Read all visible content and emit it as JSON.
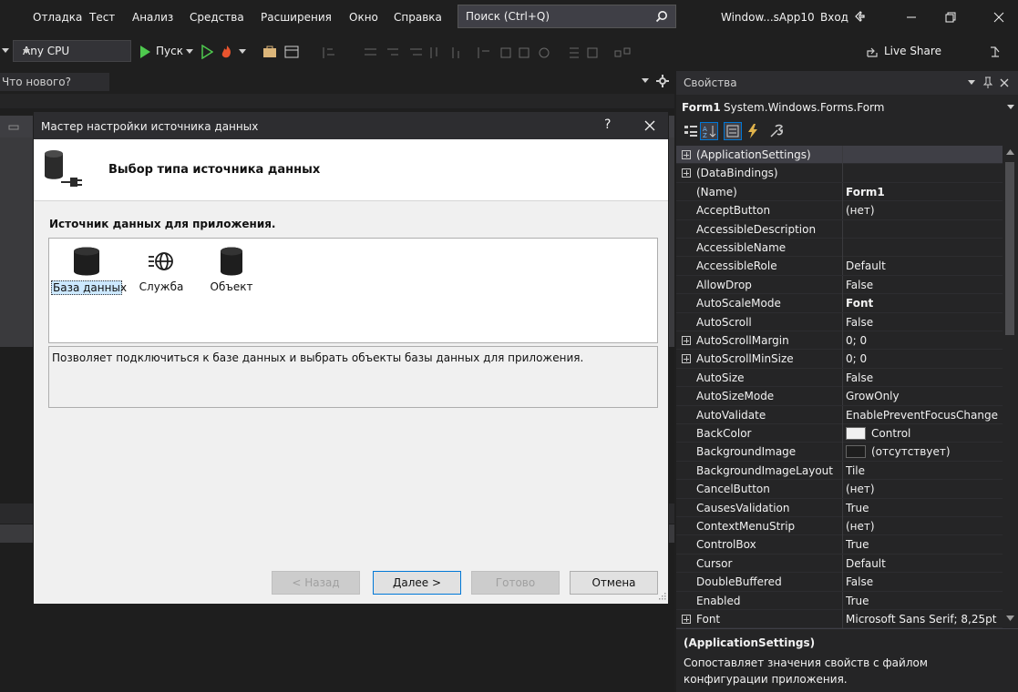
{
  "menu": {
    "items": [
      "Отладка",
      "Тест",
      "Анализ",
      "Средства",
      "Расширения",
      "Окно",
      "Справка"
    ],
    "search_placeholder": "Поиск (Ctrl+Q)",
    "window_title": "Window...sApp10",
    "signin": "Вход"
  },
  "toolbar": {
    "platform": "Any CPU",
    "run_label": "Пуск",
    "live_share": "Live Share"
  },
  "doc_tab": {
    "label": "Что нового?"
  },
  "wizard": {
    "title": "Мастер настройки источника данных",
    "help": "?",
    "heading": "Выбор типа источника данных",
    "source_label": "Источник данных для приложения.",
    "sources": [
      {
        "label": "База данных",
        "icon": "database-icon",
        "selected": true
      },
      {
        "label": "Служба",
        "icon": "service-globe-icon",
        "selected": false
      },
      {
        "label": "Объект",
        "icon": "object-cylinder-icon",
        "selected": false
      }
    ],
    "description": "Позволяет подключиться к базе данных и выбрать объекты базы данных для приложения.",
    "buttons": {
      "back": "< Назад",
      "next": "Далее >",
      "finish": "Готово",
      "cancel": "Отмена"
    }
  },
  "properties": {
    "title": "Свойства",
    "object_name": "Form1",
    "object_type": "System.Windows.Forms.Form",
    "rows": [
      {
        "name": "(ApplicationSettings)",
        "value": "",
        "expandable": true,
        "selected": true
      },
      {
        "name": "(DataBindings)",
        "value": "",
        "expandable": true
      },
      {
        "name": "(Name)",
        "value": "Form1",
        "bold": true
      },
      {
        "name": "AcceptButton",
        "value": "(нет)"
      },
      {
        "name": "AccessibleDescription",
        "value": ""
      },
      {
        "name": "AccessibleName",
        "value": ""
      },
      {
        "name": "AccessibleRole",
        "value": "Default"
      },
      {
        "name": "AllowDrop",
        "value": "False"
      },
      {
        "name": "AutoScaleMode",
        "value": "Font",
        "bold": true
      },
      {
        "name": "AutoScroll",
        "value": "False"
      },
      {
        "name": "AutoScrollMargin",
        "value": "0; 0",
        "expandable": true
      },
      {
        "name": "AutoScrollMinSize",
        "value": "0; 0",
        "expandable": true
      },
      {
        "name": "AutoSize",
        "value": "False"
      },
      {
        "name": "AutoSizeMode",
        "value": "GrowOnly"
      },
      {
        "name": "AutoValidate",
        "value": "EnablePreventFocusChange"
      },
      {
        "name": "BackColor",
        "value": "Control",
        "swatch": "#f0f0f0"
      },
      {
        "name": "BackgroundImage",
        "value": "(отсутствует)",
        "swatch": "#1e1e1e"
      },
      {
        "name": "BackgroundImageLayout",
        "value": "Tile"
      },
      {
        "name": "CancelButton",
        "value": "(нет)"
      },
      {
        "name": "CausesValidation",
        "value": "True"
      },
      {
        "name": "ContextMenuStrip",
        "value": "(нет)"
      },
      {
        "name": "ControlBox",
        "value": "True"
      },
      {
        "name": "Cursor",
        "value": "Default"
      },
      {
        "name": "DoubleBuffered",
        "value": "False"
      },
      {
        "name": "Enabled",
        "value": "True"
      },
      {
        "name": "Font",
        "value": "Microsoft Sans Serif; 8,25pt",
        "expandable": true
      }
    ],
    "desc_title": "(ApplicationSettings)",
    "desc_text": "Сопоставляет значения свойств с файлом конфигурации приложения."
  },
  "colors": {
    "accent": "#0078d7",
    "run_green": "#4ec94e",
    "selected_row": "#3f3f46",
    "dialog_bg": "#f0f0f0"
  }
}
